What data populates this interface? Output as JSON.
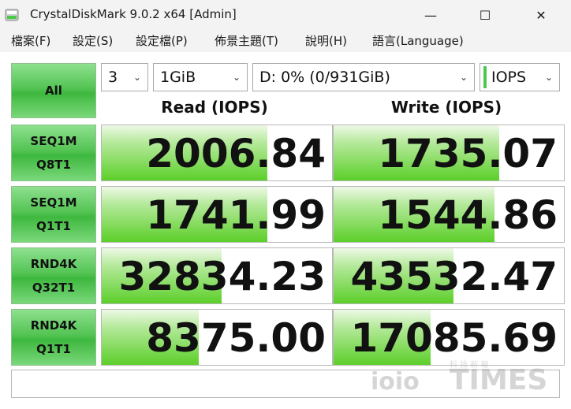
{
  "window": {
    "title": "CrystalDiskMark 9.0.2 x64 [Admin]",
    "minimize": "—",
    "maximize": "☐",
    "close": "✕"
  },
  "menu": [
    "檔案(F)",
    "設定(S)",
    "設定檔(P)",
    "佈景主題(T)",
    "說明(H)",
    "語言(Language)"
  ],
  "controls": {
    "all_label": "All",
    "count": "3",
    "size": "1GiB",
    "drive": "D: 0% (0/931GiB)",
    "unit": "IOPS"
  },
  "headers": {
    "read": "Read (IOPS)",
    "write": "Write (IOPS)"
  },
  "tests": [
    {
      "line1": "SEQ1M",
      "line2": "Q8T1",
      "read": "2006.84",
      "write": "1735.07",
      "read_fill": 0.72,
      "write_fill": 0.72
    },
    {
      "line1": "SEQ1M",
      "line2": "Q1T1",
      "read": "1741.99",
      "write": "1544.86",
      "read_fill": 0.72,
      "write_fill": 0.7
    },
    {
      "line1": "RND4K",
      "line2": "Q32T1",
      "read": "32834.23",
      "write": "43532.47",
      "read_fill": 0.52,
      "write_fill": 0.52
    },
    {
      "line1": "RND4K",
      "line2": "Q1T1",
      "read": "8375.00",
      "write": "17085.69",
      "read_fill": 0.42,
      "write_fill": 0.42
    }
  ],
  "comment": "",
  "watermark": {
    "text": "TIMES",
    "small": "科 技 新 報",
    "logo": "ioio"
  },
  "colors": {
    "accent": "#3eb83e",
    "fill": "#5ccf2a"
  }
}
